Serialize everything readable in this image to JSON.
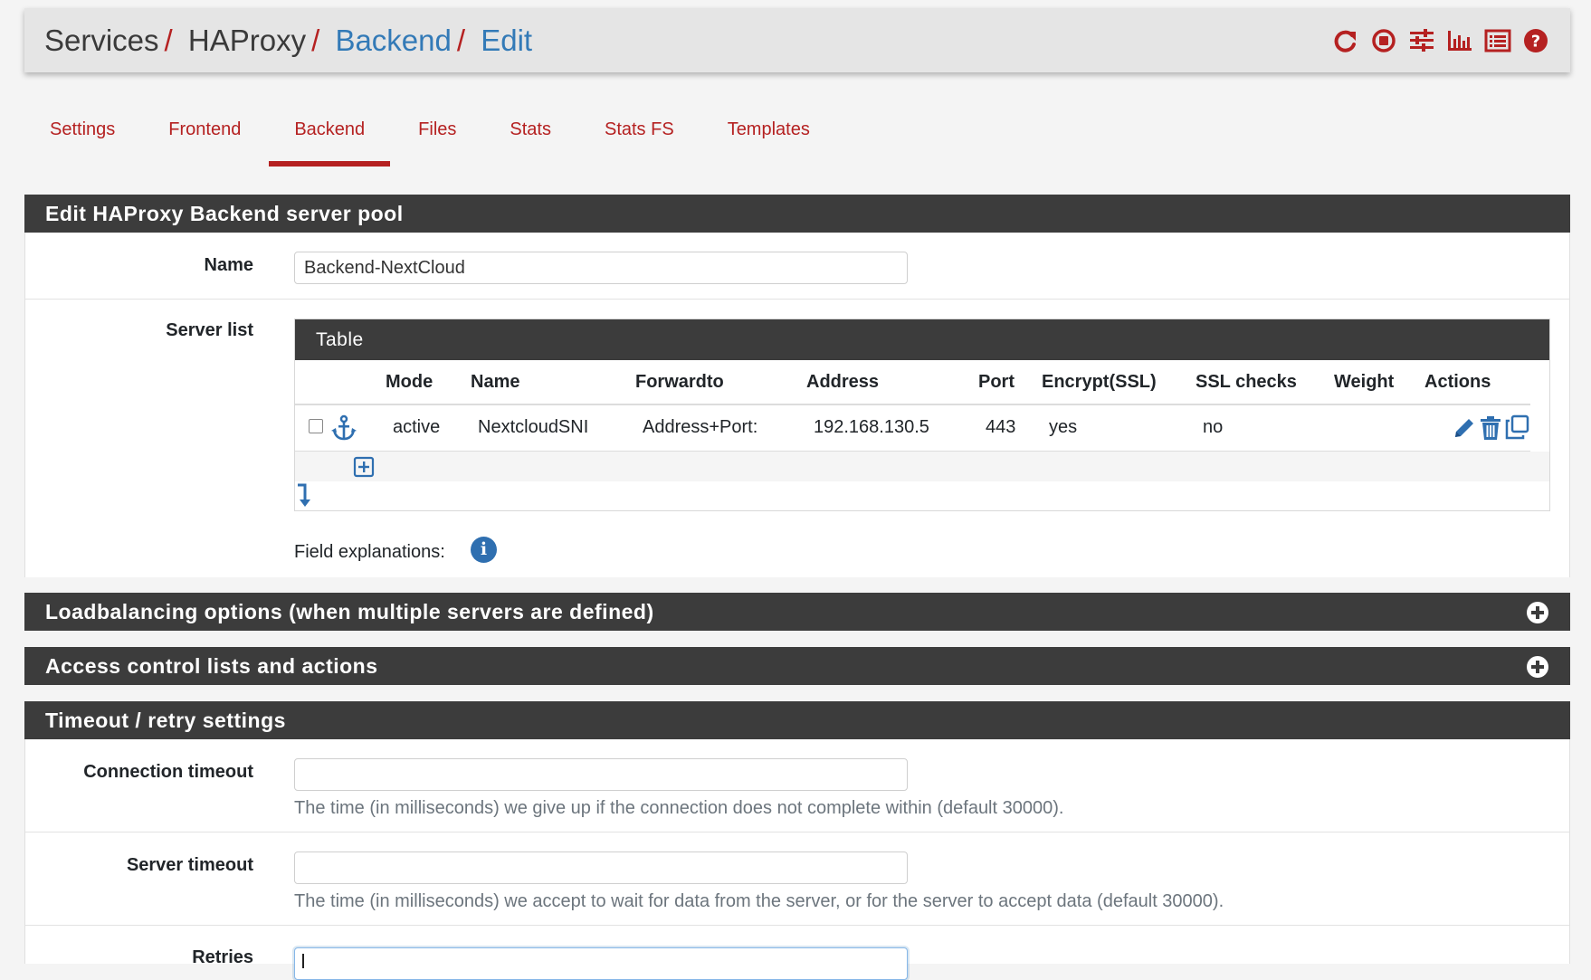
{
  "breadcrumb": {
    "items": [
      {
        "label": "Services",
        "link": false
      },
      {
        "label": "HAProxy",
        "link": false
      },
      {
        "label": "Backend",
        "link": true
      },
      {
        "label": "Edit",
        "link": true
      }
    ],
    "separator": "/"
  },
  "header_icons": [
    "reload-icon",
    "stop-circle-icon",
    "sliders-icon",
    "bar-chart-icon",
    "list-icon",
    "help-icon"
  ],
  "tabs": [
    {
      "label": "Settings",
      "active": false
    },
    {
      "label": "Frontend",
      "active": false
    },
    {
      "label": "Backend",
      "active": true
    },
    {
      "label": "Files",
      "active": false
    },
    {
      "label": "Stats",
      "active": false
    },
    {
      "label": "Stats FS",
      "active": false
    },
    {
      "label": "Templates",
      "active": false
    }
  ],
  "edit_panel": {
    "title": "Edit HAProxy Backend server pool",
    "name_label": "Name",
    "name_value": "Backend-NextCloud",
    "server_list_label": "Server list",
    "table": {
      "title": "Table",
      "columns": [
        "Mode",
        "Name",
        "Forwardto",
        "Address",
        "Port",
        "Encrypt(SSL)",
        "SSL checks",
        "Weight",
        "Actions"
      ],
      "rows": [
        {
          "mode": "active",
          "name": "NextcloudSNI",
          "forwardto": "Address+Port:",
          "address": "192.168.130.5",
          "port": "443",
          "encrypt": "yes",
          "ssl_checks": "no",
          "weight": ""
        }
      ]
    },
    "field_explanations_label": "Field explanations:"
  },
  "collapsed_panels": [
    {
      "title": "Loadbalancing options (when multiple servers are defined)"
    },
    {
      "title": "Access control lists and actions"
    }
  ],
  "timeout_panel": {
    "title": "Timeout / retry settings",
    "connection_timeout": {
      "label": "Connection timeout",
      "value": "",
      "help": "The time (in milliseconds) we give up if the connection does not complete within (default 30000)."
    },
    "server_timeout": {
      "label": "Server timeout",
      "value": "",
      "help": "The time (in milliseconds) we accept to wait for data from the server, or for the server to accept data (default 30000)."
    },
    "retries": {
      "label": "Retries",
      "value": ""
    }
  },
  "colors": {
    "accent_red": "#b52121",
    "link_blue": "#337ab7",
    "panel_dark": "#3c3c3c",
    "icon_blue": "#2f6fb0"
  }
}
